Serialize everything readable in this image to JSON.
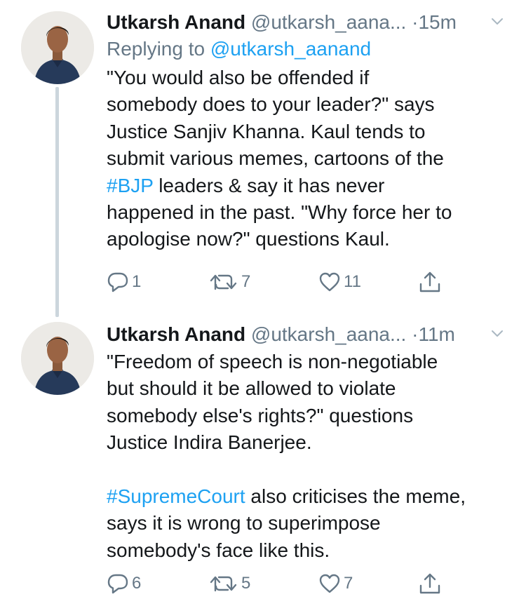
{
  "tweets": [
    {
      "name": "Utkarsh Anand",
      "handle": "@utkarsh_aana...",
      "time": "15m",
      "replying_prefix": "Replying to ",
      "replying_to": "@utkarsh_aanand",
      "body": {
        "p1": "\"You would also be offended if\nsomebody does to your leader?\" says\nJustice Sanjiv Khanna. Kaul tends to\nsubmit various memes, cartoons of the\n",
        "hashtag": "#BJP",
        "p2": " leaders & say it has never\nhappened in the past. \"Why force her to\napologise now?\" questions Kaul."
      },
      "counts": {
        "replies": "1",
        "retweets": "7",
        "likes": "11"
      }
    },
    {
      "name": "Utkarsh Anand",
      "handle": "@utkarsh_aana...",
      "time": "11m",
      "body": {
        "p1": "\"Freedom of speech is non-negotiable\nbut should it be allowed to violate\nsomebody else's rights?\" questions\nJustice Indira Banerjee.\n\n",
        "hashtag": "#SupremeCourt",
        "p2": " also criticises the meme,\nsays it is wrong to superimpose\nsomebody's face like this."
      },
      "counts": {
        "replies": "6",
        "retweets": "5",
        "likes": "7"
      }
    }
  ],
  "separator": "·",
  "icons": {
    "reply": "reply-icon",
    "retweet": "retweet-icon",
    "like": "heart-icon",
    "share": "share-icon",
    "caret": "chevron-down-icon"
  },
  "colors": {
    "link": "#1da1f2",
    "secondary": "#657786",
    "text": "#14171a",
    "thread_line": "#ccd6dd"
  }
}
